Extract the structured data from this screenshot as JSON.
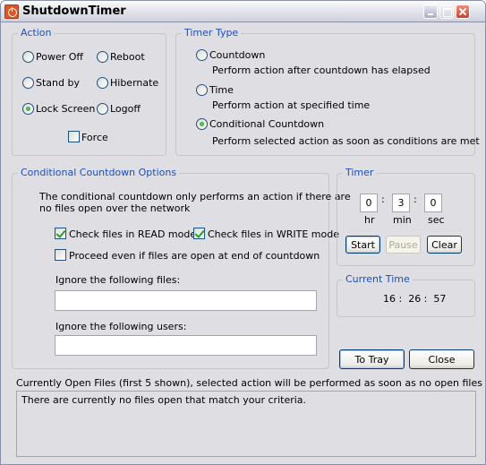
{
  "window": {
    "title": "ShutdownTimer",
    "controls": {
      "minimize": "minimize-icon",
      "maximize": "maximize-icon",
      "close": "close-icon"
    }
  },
  "action": {
    "label": "Action",
    "options": [
      {
        "label": "Power Off",
        "selected": false
      },
      {
        "label": "Reboot",
        "selected": false
      },
      {
        "label": "Stand by",
        "selected": false
      },
      {
        "label": "Hibernate",
        "selected": false
      },
      {
        "label": "Lock Screen",
        "selected": true
      },
      {
        "label": "Logoff",
        "selected": false
      }
    ],
    "force": {
      "label": "Force",
      "checked": false
    }
  },
  "timer_type": {
    "label": "Timer Type",
    "options": [
      {
        "label": "Countdown",
        "desc": "Perform action after countdown has elapsed",
        "selected": false
      },
      {
        "label": "Time",
        "desc": "Perform action at specified time",
        "selected": false
      },
      {
        "label": "Conditional Countdown",
        "desc": "Perform selected action as soon as conditions are met",
        "selected": true
      }
    ]
  },
  "conditional": {
    "label": "Conditional Countdown Options",
    "description_line1": "The conditional countdown only performs an action if there are",
    "description_line2": "no files open over the network",
    "check_read": {
      "label": "Check files in READ mode",
      "checked": true
    },
    "check_write": {
      "label": "Check files in WRITE mode",
      "checked": true
    },
    "proceed": {
      "label": "Proceed even if files are open at end of countdown",
      "checked": false
    },
    "ignore_files": {
      "label": "Ignore the following files:",
      "value": ""
    },
    "ignore_users": {
      "label": "Ignore the following users:",
      "value": ""
    }
  },
  "timer": {
    "label": "Timer",
    "hr": "0",
    "min": "3",
    "sec": "0",
    "hr_label": "hr",
    "min_label": "min",
    "sec_label": "sec",
    "separator": ":",
    "start": "Start",
    "pause": "Pause",
    "clear": "Clear"
  },
  "current_time": {
    "label": "Current Time",
    "value": "16 :  26 :  57"
  },
  "buttons": {
    "to_tray": "To Tray",
    "close": "Close"
  },
  "open_files": {
    "label": "Currently Open Files (first 5 shown), selected action will be performed as soon as no open files are listed:",
    "message": "There are currently no files open that match your criteria."
  }
}
